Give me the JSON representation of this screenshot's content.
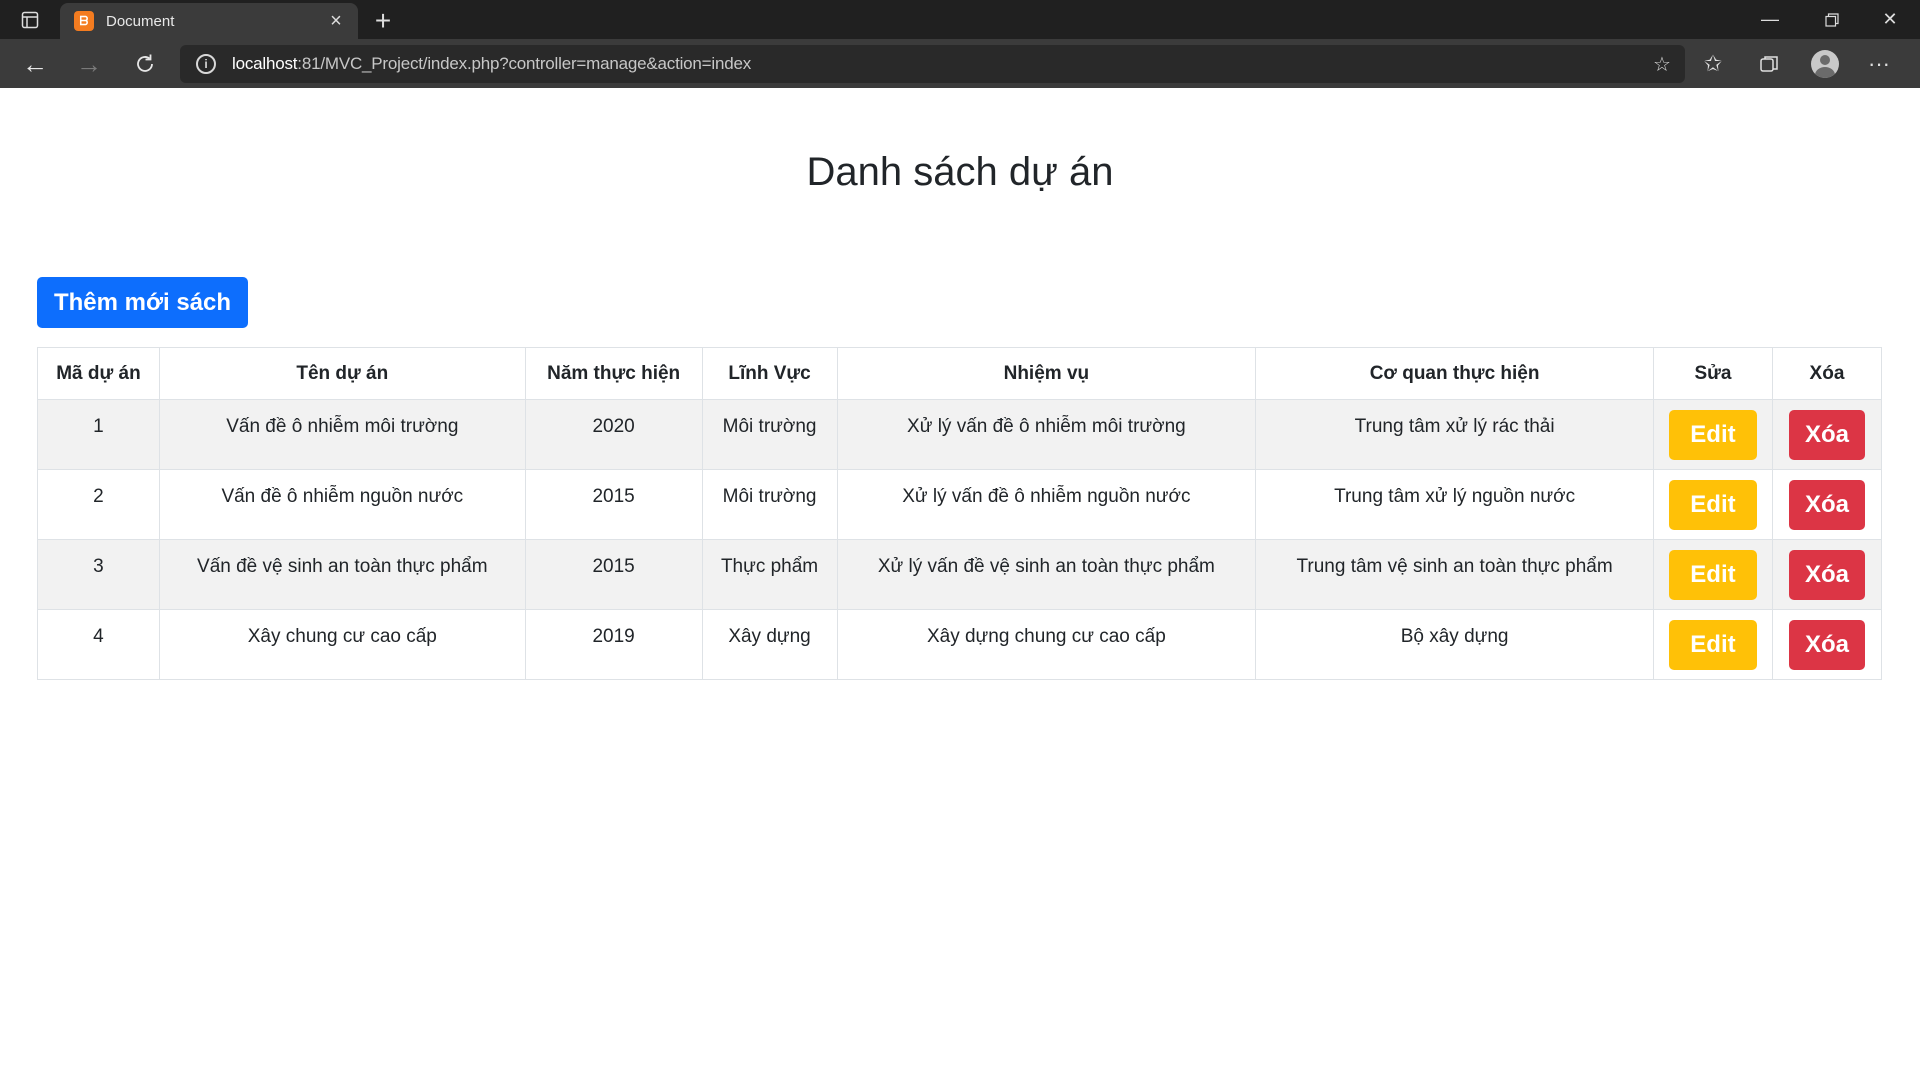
{
  "browser": {
    "tab_title": "Document",
    "tab_favicon": "xampp-icon",
    "url_host": "localhost",
    "url_rest": ":81/MVC_Project/index.php?controller=manage&action=index"
  },
  "page": {
    "title": "Danh sách dự án",
    "add_button": "Thêm mới sách"
  },
  "table": {
    "headers": [
      "Mã dự án",
      "Tên dự án",
      "Năm thực hiện",
      "Lĩnh Vực",
      "Nhiệm vụ",
      "Cơ quan thực hiện",
      "Sửa",
      "Xóa"
    ],
    "rows": [
      {
        "id": "1",
        "name": "Vấn đề ô nhiễm môi trường",
        "year": "2020",
        "field": "Môi trường",
        "task": "Xử lý vấn đề ô nhiễm môi trường",
        "agency": "Trung tâm xử lý rác thải",
        "edit": "Edit",
        "delete": "Xóa"
      },
      {
        "id": "2",
        "name": "Vấn đề ô nhiễm nguồn nước",
        "year": "2015",
        "field": "Môi trường",
        "task": "Xử lý vấn đề ô nhiễm nguồn nước",
        "agency": "Trung tâm xử lý nguồn nước",
        "edit": "Edit",
        "delete": "Xóa"
      },
      {
        "id": "3",
        "name": "Vấn đề vệ sinh an toàn thực phẩm",
        "year": "2015",
        "field": "Thực phẩm",
        "task": "Xử lý vấn đề vệ sinh an toàn thực phẩm",
        "agency": "Trung tâm vệ sinh an toàn thực phẩm",
        "edit": "Edit",
        "delete": "Xóa"
      },
      {
        "id": "4",
        "name": "Xây chung cư cao cấp",
        "year": "2019",
        "field": "Xây dựng",
        "task": "Xây dựng chung cư cao cấp",
        "agency": "Bộ xây dựng",
        "edit": "Edit",
        "delete": "Xóa"
      }
    ]
  },
  "colors": {
    "primary": "#0d6efd",
    "warning": "#ffc107",
    "danger": "#dc3545"
  }
}
